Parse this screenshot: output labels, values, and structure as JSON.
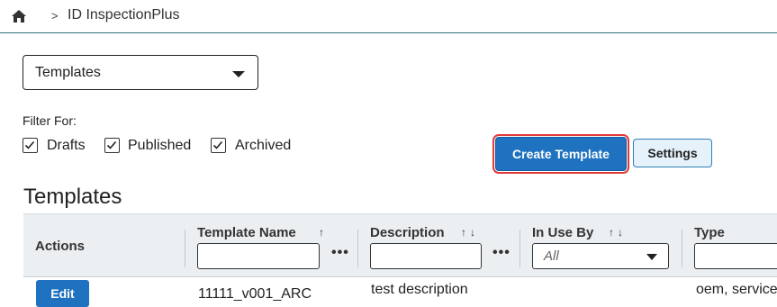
{
  "breadcrumb": {
    "separator": ">",
    "current": "ID InspectionPlus"
  },
  "view_select": {
    "value": "Templates"
  },
  "filter": {
    "label": "Filter For:",
    "options": [
      {
        "label": "Drafts",
        "checked": true
      },
      {
        "label": "Published",
        "checked": true
      },
      {
        "label": "Archived",
        "checked": true
      }
    ]
  },
  "buttons": {
    "create_template": "Create Template",
    "settings": "Settings"
  },
  "section_title": "Templates",
  "table": {
    "columns": {
      "actions": "Actions",
      "template_name": "Template Name",
      "template_name_sort": "↑",
      "description": "Description",
      "description_sort": "↑↓",
      "in_use_by": "In Use By",
      "in_use_by_sort": "↑↓",
      "in_use_by_filter": "All",
      "type": "Type",
      "more": "•••"
    },
    "rows": [
      {
        "action": "Edit",
        "template_name": "11111_v001_ARC",
        "description": "test description",
        "in_use_by": "",
        "type": "oem, service"
      }
    ]
  },
  "colors": {
    "accent": "#1f72bf",
    "highlight": "#e03a3a",
    "header_rule": "#2b6f7b"
  },
  "icons": {
    "home": "home-icon",
    "checkbox": "check-icon",
    "dropdown": "caret-down-icon"
  }
}
